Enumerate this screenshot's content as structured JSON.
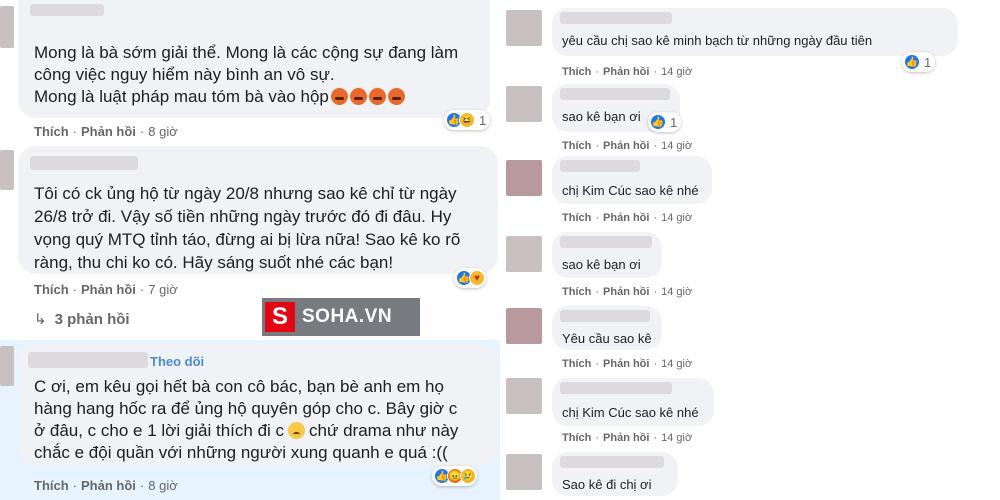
{
  "left": {
    "comments": [
      {
        "lines": [
          "Mong là bà sớm giải thể. Mong là các cộng sự đang làm",
          "công việc nguy hiểm này bình an vô sự.",
          "Mong là luật pháp mau tóm bà vào hộp"
        ],
        "like_label": "Thích",
        "reply_label": "Phản hồi",
        "time": "8 giờ",
        "reaction_count": "1"
      },
      {
        "lines": [
          "Tôi có ck ủng hộ từ ngày 20/8 nhưng sao kê chỉ từ ngày",
          "26/8 trở đi. Vậy số tiền những ngày trước đó đi đâu. Hy",
          "vọng quý MTQ tỉnh táo, đừng ai bị lừa nữa! Sao kê ko rõ",
          "ràng, thu chi ko có. Hãy sáng suốt nhé các bạn!"
        ],
        "like_label": "Thích",
        "reply_label": "Phản hồi",
        "time": "7 giờ",
        "replies_label": "3 phản hồi"
      },
      {
        "follow_label": "Theo dõi",
        "lines": [
          "C ơi, em kêu gọi hết bà con cô bác, bạn bè anh em họ",
          "hàng hang hốc ra để ủng hộ quyên góp cho c. Bây giờ c",
          "chắc e đội quần với những người xung quanh e quá :(("
        ],
        "line3_a": "ở đâu, c cho e 1 lời giải thích đi c",
        "line3_b": "chứ drama như này",
        "like_label": "Thích",
        "reply_label": "Phản hồi",
        "time": "8 giờ"
      }
    ]
  },
  "watermark": {
    "logo": "S",
    "text": "SOHA.VN"
  },
  "right": {
    "comments": [
      {
        "text": "yêu cầu chị sao kê minh bạch từ những ngày đầu tiên",
        "like_label": "Thích",
        "reply_label": "Phản hồi",
        "time": "14 giờ",
        "reaction_count": "1"
      },
      {
        "text": "sao kê bạn ơi",
        "like_label": "Thích",
        "reply_label": "Phản hồi",
        "time": "14 giờ",
        "reaction_count": "1"
      },
      {
        "text": "chị Kim Cúc sao kê nhé",
        "like_label": "Thích",
        "reply_label": "Phản hồi",
        "time": "14 giờ"
      },
      {
        "text": "sao kê bạn ơi",
        "like_label": "Thích",
        "reply_label": "Phản hồi",
        "time": "14 giờ"
      },
      {
        "text": "Yêu cầu sao kê",
        "like_label": "Thích",
        "reply_label": "Phản hồi",
        "time": "14 giờ"
      },
      {
        "text": "chị Kim Cúc sao kê nhé",
        "like_label": "Thích",
        "reply_label": "Phản hồi",
        "time": "14 giờ"
      },
      {
        "text": "Sao kê đi chị ơi"
      }
    ]
  }
}
